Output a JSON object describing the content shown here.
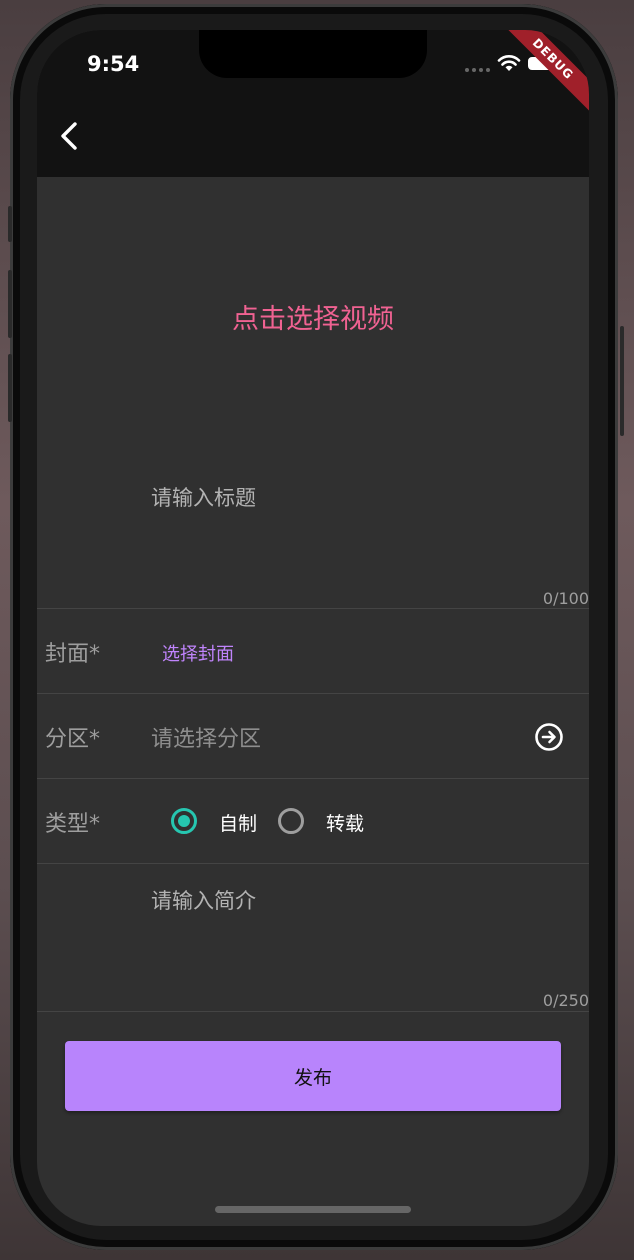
{
  "status_bar": {
    "time": "9:54",
    "debug_label": "DEBUG"
  },
  "app_bar": {
    "back_icon": "chevron-left-icon"
  },
  "video_picker": {
    "label": "点击选择视频"
  },
  "title_field": {
    "placeholder": "请输入标题",
    "counter": "0/100"
  },
  "cover_row": {
    "label": "封面*",
    "action": "选择封面"
  },
  "partition_row": {
    "label": "分区*",
    "placeholder": "请选择分区",
    "icon": "arrow-right-circle-icon"
  },
  "type_row": {
    "label": "类型*",
    "options": [
      {
        "label": "自制",
        "selected": true
      },
      {
        "label": "转载",
        "selected": false
      }
    ]
  },
  "intro_field": {
    "placeholder": "请输入简介",
    "counter": "0/250"
  },
  "publish_button": {
    "label": "发布"
  },
  "colors": {
    "background": "#303030",
    "app_bar": "#121212",
    "accent_pink": "#f06292",
    "accent_purple": "#b884fc",
    "radio_teal": "#26c6b0"
  }
}
